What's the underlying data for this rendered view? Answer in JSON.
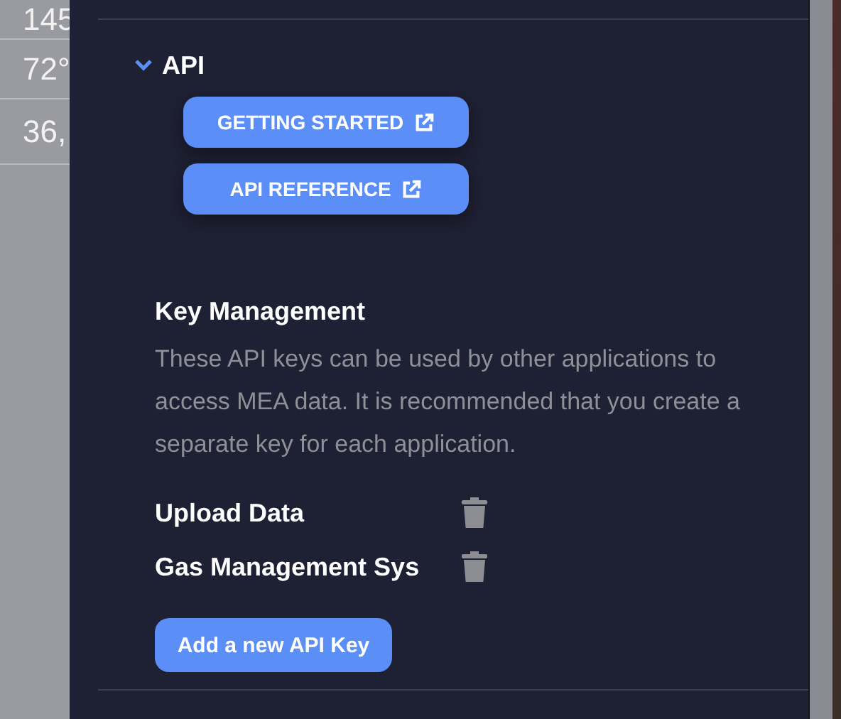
{
  "background_table": {
    "cells": [
      "145",
      "72°",
      "36,"
    ]
  },
  "api_section": {
    "title": "API",
    "expanded": true,
    "links": [
      {
        "label": "GETTING STARTED"
      },
      {
        "label": "API REFERENCE"
      }
    ]
  },
  "key_management": {
    "title": "Key Management",
    "description": "These API keys can be used by other applications to access MEA data. It is recommended that you create a separate key for each application.",
    "keys": [
      {
        "name": "Upload Data"
      },
      {
        "name": "Gas Management Sys"
      }
    ],
    "add_button": "Add a new API Key"
  }
}
